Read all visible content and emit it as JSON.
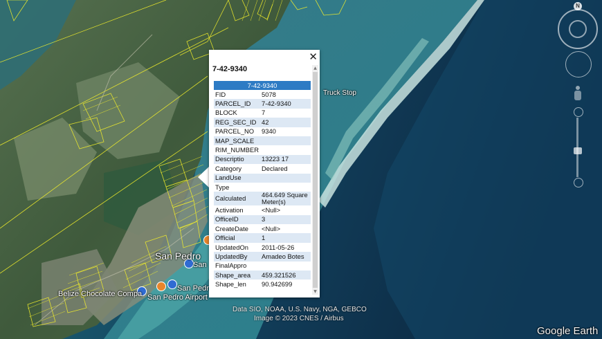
{
  "popup": {
    "title": "7-42-9340",
    "table_header": "7-42-9340",
    "close_glyph": "✕",
    "rows": [
      {
        "key": "FID",
        "value": "5078"
      },
      {
        "key": "PARCEL_ID",
        "value": "7-42-9340"
      },
      {
        "key": "BLOCK",
        "value": "7"
      },
      {
        "key": "REG_SEC_ID",
        "value": "42"
      },
      {
        "key": "PARCEL_NO",
        "value": "9340"
      },
      {
        "key": "MAP_SCALE",
        "value": ""
      },
      {
        "key": "RIM_NUMBER",
        "value": ""
      },
      {
        "key": "Descriptio",
        "value": "13223 17"
      },
      {
        "key": "Category",
        "value": "Declared"
      },
      {
        "key": "LandUse",
        "value": ""
      },
      {
        "key": "Type",
        "value": ""
      },
      {
        "key": "Calculated",
        "value": "464.649 Square Meter(s)"
      },
      {
        "key": "Activation",
        "value": "<Null>"
      },
      {
        "key": "OfficeID",
        "value": "3"
      },
      {
        "key": "CreateDate",
        "value": "<Null>"
      },
      {
        "key": "Official",
        "value": "1"
      },
      {
        "key": "UpdatedOn",
        "value": "2011-05-26"
      },
      {
        "key": "UpdatedBy",
        "value": "Amadeo Botes"
      },
      {
        "key": "FinalAppro",
        "value": ""
      },
      {
        "key": "Shape_area",
        "value": "459.321526"
      },
      {
        "key": "Shape_len",
        "value": "90.942699"
      }
    ]
  },
  "map_labels": {
    "san_pedro": "San Pedro",
    "san_pedro_partial": "San",
    "truck_stop": "Truck Stop",
    "belize_chocolate": "Belize Chocolate Compa",
    "san_pedro_2": "San Pedr",
    "san_pedro_airport": "San Pedro Airport"
  },
  "credits": {
    "line1": "Data SIO, NOAA, U.S. Navy, NGA, GEBCO",
    "line2": "Image © 2023 CNES / Airbus",
    "brand": "Google Earth"
  },
  "controls": {
    "north_label": "N"
  },
  "colors": {
    "parcel_lines": "#f2ee2a",
    "table_header": "#2d7bc4",
    "row_alt": "#dde8f4"
  }
}
